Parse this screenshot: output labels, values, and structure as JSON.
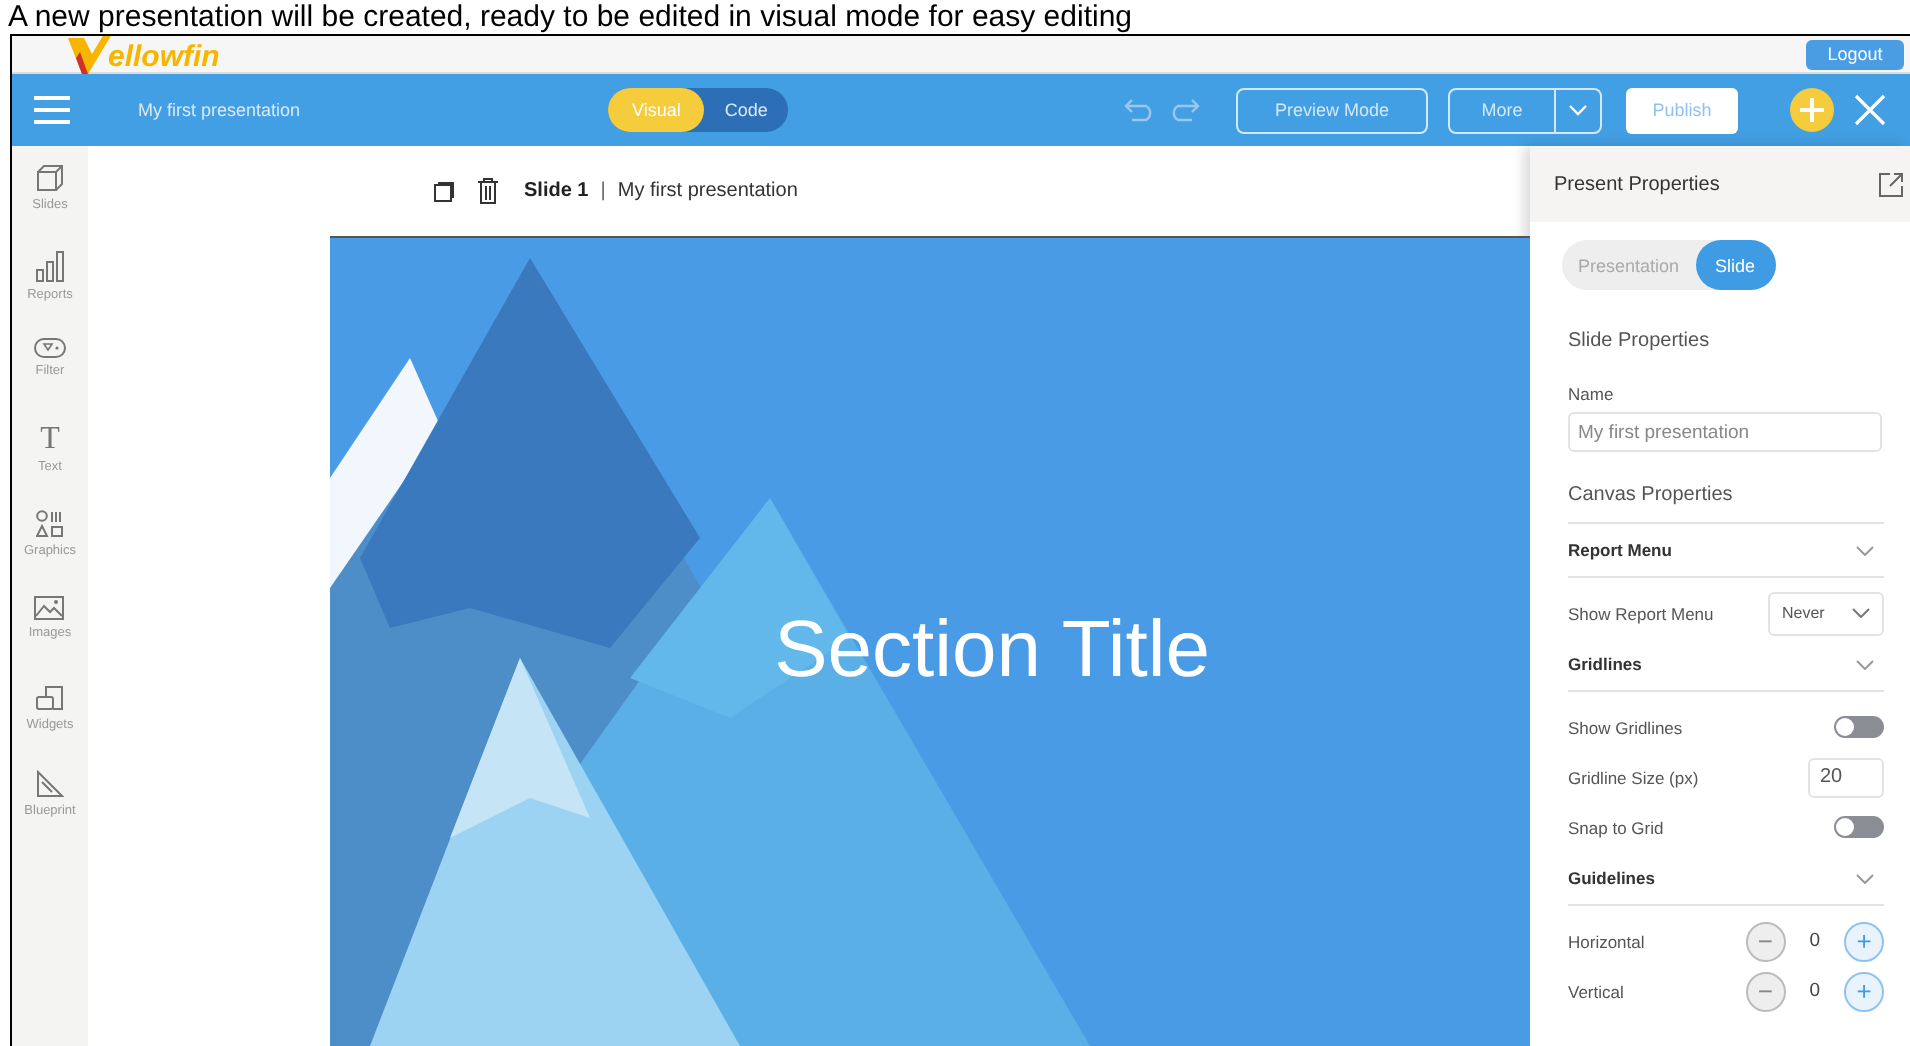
{
  "caption": "A new presentation will be created, ready to be edited in visual mode for easy editing",
  "logo": {
    "text": "ellowfin"
  },
  "logout": "Logout",
  "toolbar": {
    "title": "My first presentation",
    "modes": [
      {
        "label": "Visual",
        "selected": true
      },
      {
        "label": "Code",
        "selected": false
      }
    ],
    "preview": "Preview Mode",
    "more": "More",
    "publish": "Publish"
  },
  "sidebar": {
    "items": [
      {
        "kind": "slides",
        "label": "Slides"
      },
      {
        "kind": "reports",
        "label": "Reports"
      },
      {
        "kind": "filter",
        "label": "Filter"
      },
      {
        "kind": "text",
        "label": "Text",
        "glyph": "T"
      },
      {
        "kind": "graphics",
        "label": "Graphics"
      },
      {
        "kind": "images",
        "label": "Images"
      },
      {
        "kind": "widgets",
        "label": "Widgets"
      },
      {
        "kind": "blueprint",
        "label": "Blueprint"
      }
    ]
  },
  "slide_header": {
    "name": "Slide 1",
    "separator": "|",
    "title": "My first presentation"
  },
  "slide": {
    "title": "Section Title"
  },
  "panel": {
    "title": "Present Properties",
    "tabs": [
      {
        "label": "Presentation",
        "selected": false
      },
      {
        "label": "Slide",
        "selected": true
      }
    ],
    "section": "Slide Properties",
    "name_label": "Name",
    "name_placeholder": "My first presentation",
    "canvas": "Canvas Properties",
    "rows": [
      {
        "kind": "header",
        "label": "Report Menu"
      },
      {
        "kind": "select",
        "label": "Show Report Menu",
        "value": "Never"
      },
      {
        "kind": "header",
        "label": "Gridlines"
      },
      {
        "kind": "toggle",
        "label": "Show Gridlines",
        "on": false
      },
      {
        "kind": "number",
        "label": "Gridline Size (px)",
        "value": "20"
      },
      {
        "kind": "toggle",
        "label": "Snap to Grid",
        "on": false
      },
      {
        "kind": "header",
        "label": "Guidelines"
      },
      {
        "kind": "stepper",
        "label": "Horizontal",
        "value": "0",
        "minus": "−",
        "plus": "+"
      },
      {
        "kind": "stepper",
        "label": "Vertical",
        "value": "0",
        "minus": "−",
        "plus": "+"
      }
    ]
  }
}
